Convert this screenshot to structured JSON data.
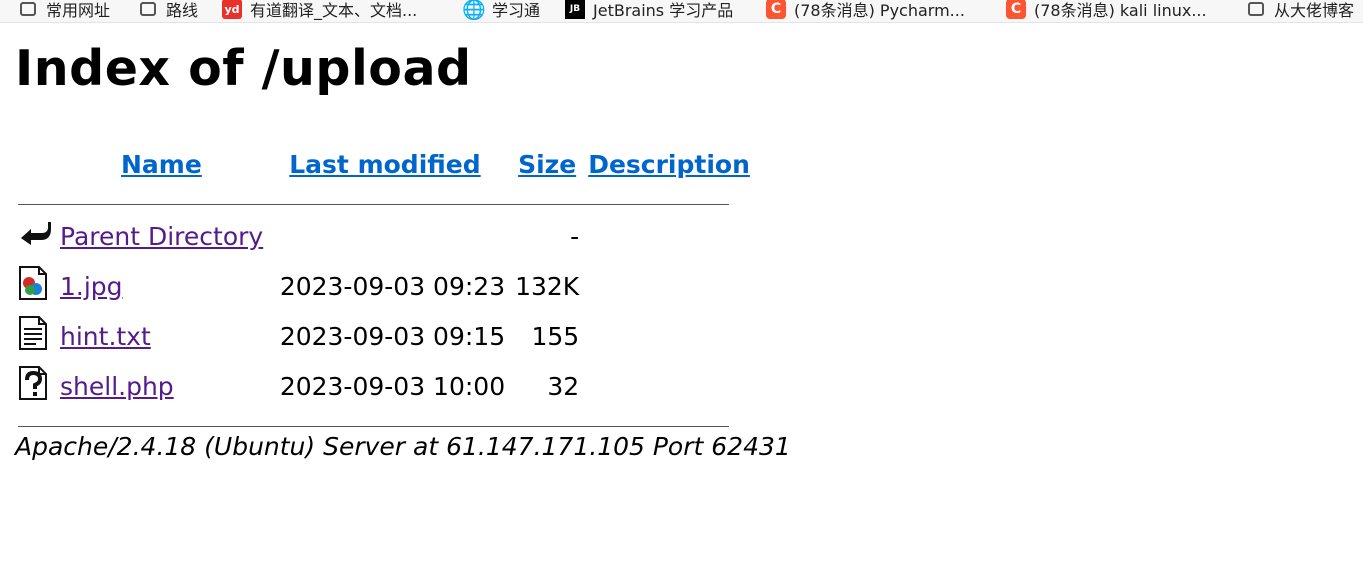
{
  "bookmarks": [
    {
      "label": "常用网址",
      "icon": "folder-icon"
    },
    {
      "label": "路线",
      "icon": "folder-icon"
    },
    {
      "label": "有道翻译_文本、文档...",
      "icon": "youdao-icon"
    },
    {
      "label": "学习通",
      "icon": "globe-icon"
    },
    {
      "label": "JetBrains 学习产品",
      "icon": "jetbrains-icon"
    },
    {
      "label": "(78条消息) Pycharm...",
      "icon": "csdn-icon"
    },
    {
      "label": "(78条消息) kali linux...",
      "icon": "csdn-icon"
    },
    {
      "label": "从大佬博客",
      "icon": "folder-icon"
    }
  ],
  "page": {
    "title": "Index of /upload",
    "columns": {
      "name": "Name",
      "last_modified": "Last modified",
      "size": "Size",
      "description": "Description"
    },
    "rows": [
      {
        "icon": "back-arrow-icon",
        "name": "Parent Directory",
        "last_modified": "",
        "size": "-",
        "description": ""
      },
      {
        "icon": "image-file-icon",
        "name": "1.jpg",
        "last_modified": "2023-09-03 09:23",
        "size": "132K",
        "description": ""
      },
      {
        "icon": "text-file-icon",
        "name": "hint.txt",
        "last_modified": "2023-09-03 09:15",
        "size": "155",
        "description": ""
      },
      {
        "icon": "unknown-file-icon",
        "name": "shell.php",
        "last_modified": "2023-09-03 10:00",
        "size": "32",
        "description": ""
      }
    ],
    "footer": "Apache/2.4.18 (Ubuntu) Server at 61.147.171.105 Port 62431"
  }
}
